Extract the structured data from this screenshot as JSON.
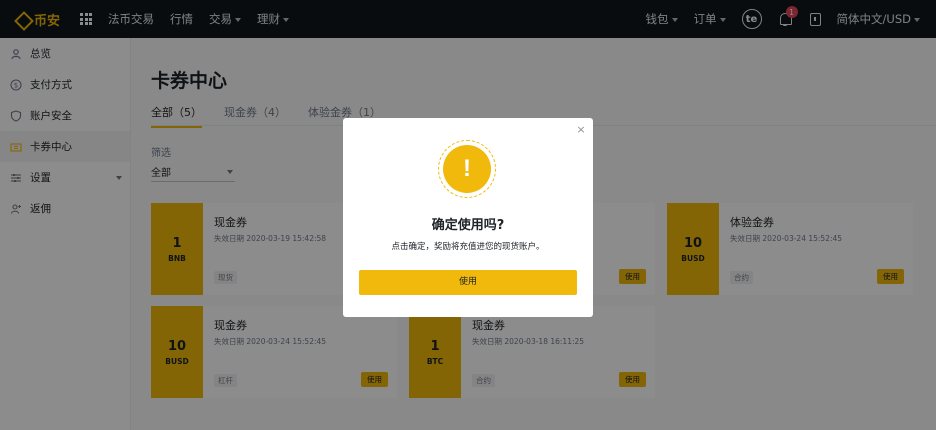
{
  "nav": {
    "logo_text": "币安",
    "items": [
      "法币交易",
      "行情",
      "交易",
      "理财"
    ],
    "right": {
      "wallet": "钱包",
      "orders": "订单",
      "avatar": "te",
      "notification_count": "1",
      "language": "简体中文/USD"
    }
  },
  "sidebar": {
    "items": [
      {
        "label": "总览",
        "icon": "user-icon"
      },
      {
        "label": "支付方式",
        "icon": "dollar-icon"
      },
      {
        "label": "账户安全",
        "icon": "shield-icon"
      },
      {
        "label": "卡券中心",
        "icon": "ticket-icon",
        "active": true
      },
      {
        "label": "设置",
        "icon": "sliders-icon"
      },
      {
        "label": "返佣",
        "icon": "add-user-icon"
      }
    ]
  },
  "main": {
    "title": "卡券中心",
    "tabs": [
      {
        "label": "全部（5）"
      },
      {
        "label": "现金券（4）"
      },
      {
        "label": "体验金券（1）"
      }
    ],
    "filter": {
      "label": "筛选",
      "value": "全部"
    },
    "cards": [
      {
        "amount": "1",
        "unit": "BNB",
        "title": "现金券",
        "expire": "失效日期 2020-03-19 15:42:58",
        "tag": "现货",
        "button": "使用"
      },
      {
        "amount": "",
        "unit": "",
        "title": "",
        "expire": "",
        "tag": "",
        "button": "使用"
      },
      {
        "amount": "10",
        "unit": "BUSD",
        "title": "体验金券",
        "expire": "失效日期 2020-03-24 15:52:45",
        "tag": "合约",
        "button": "使用"
      },
      {
        "amount": "10",
        "unit": "BUSD",
        "title": "现金券",
        "expire": "失效日期 2020-03-24 15:52:45",
        "tag": "杠杆",
        "button": "使用"
      },
      {
        "amount": "1",
        "unit": "BTC",
        "title": "现金券",
        "expire": "失效日期 2020-03-18 16:11:25",
        "tag": "合约",
        "button": "使用"
      }
    ]
  },
  "modal": {
    "close": "×",
    "icon": "warning-icon",
    "icon_glyph": "!",
    "title": "确定使用吗?",
    "description": "点击确定，奖励将充值进您的现货账户。",
    "confirm": "使用"
  },
  "colors": {
    "brand": "#f0b90b",
    "topbar": "#12161c",
    "badge": "#e64556"
  }
}
